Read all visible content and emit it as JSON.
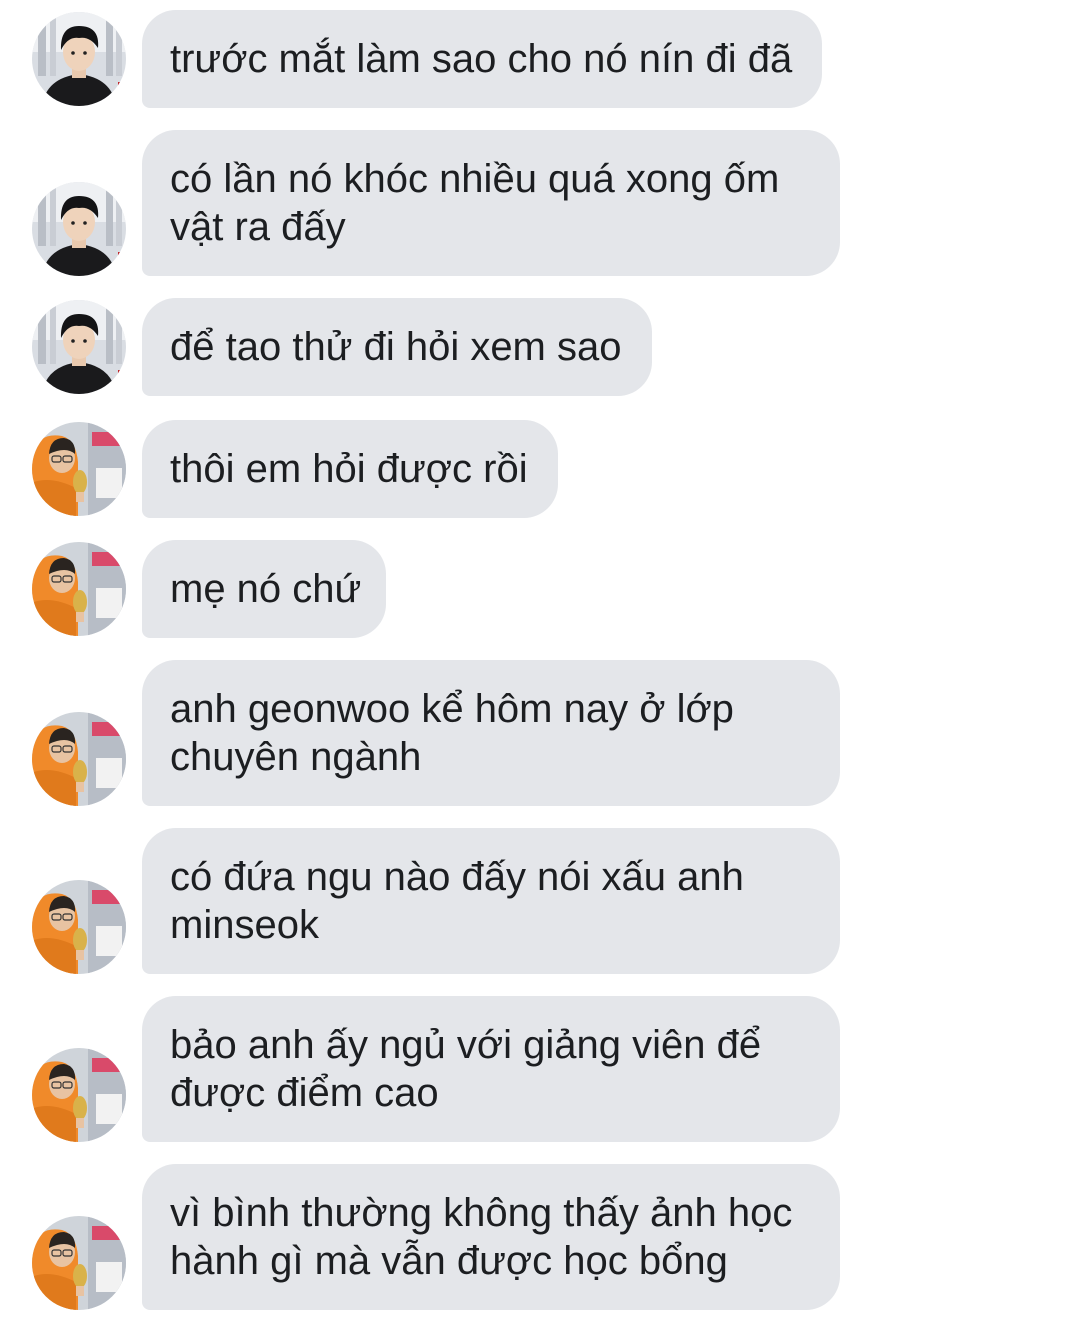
{
  "colors": {
    "bubble_bg": "#e4e6ea",
    "text": "#1c1e21",
    "background": "#ffffff"
  },
  "senders": {
    "a": {
      "avatar_icon": "avatar-dark-hair-black-shirt"
    },
    "b": {
      "avatar_icon": "avatar-orange-hoodie"
    }
  },
  "messages": [
    {
      "sender": "a",
      "text": "trước mắt làm sao cho nó nín đi đã"
    },
    {
      "sender": "a",
      "text": "có lần nó khóc nhiều quá xong ốm vật ra đấy"
    },
    {
      "sender": "a",
      "text": "để tao thử đi hỏi xem sao"
    },
    {
      "sender": "b",
      "text": "thôi em hỏi được rồi"
    },
    {
      "sender": "b",
      "text": "mẹ nó chứ"
    },
    {
      "sender": "b",
      "text": "anh geonwoo kể hôm nay ở lớp chuyên ngành"
    },
    {
      "sender": "b",
      "text": "có đứa ngu nào đấy nói xấu anh minseok"
    },
    {
      "sender": "b",
      "text": "bảo anh ấy ngủ với giảng viên để được điểm cao"
    },
    {
      "sender": "b",
      "text": "vì bình thường không thấy ảnh học hành gì mà vẫn được học bổng"
    }
  ]
}
